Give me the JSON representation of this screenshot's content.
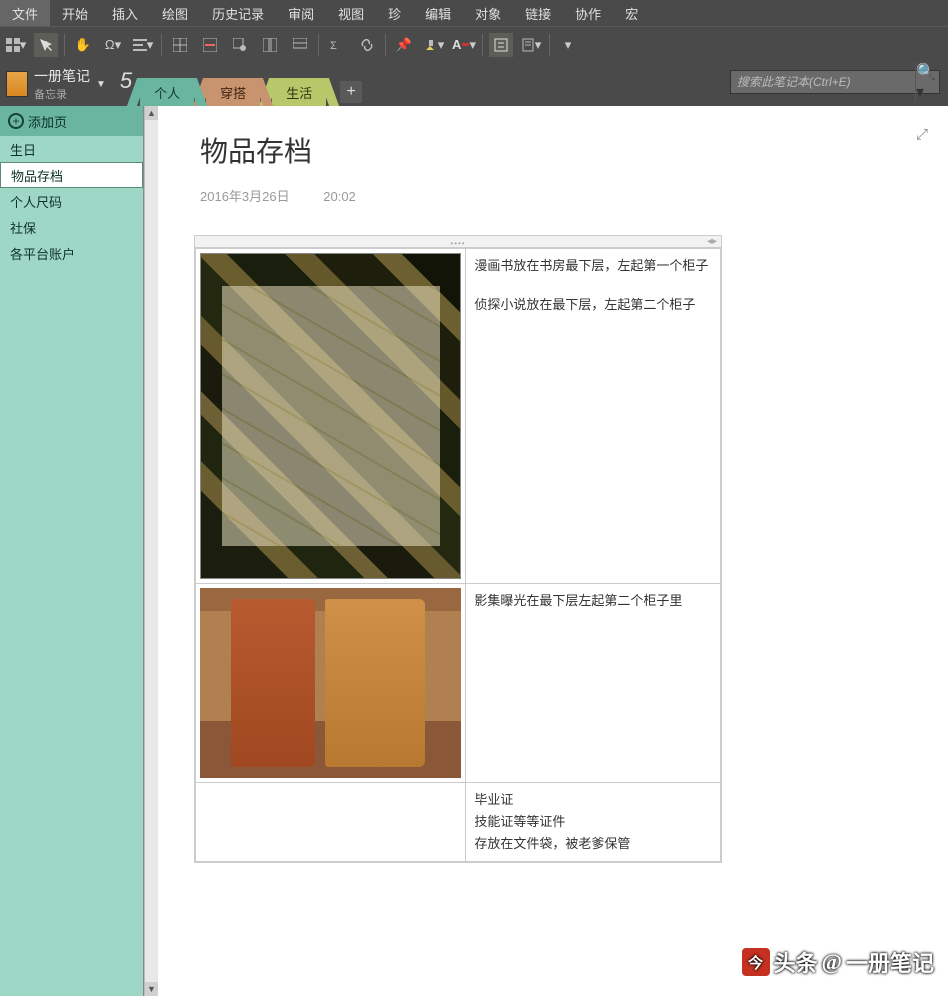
{
  "menu": {
    "items": [
      "文件",
      "开始",
      "插入",
      "绘图",
      "历史记录",
      "审阅",
      "视图",
      "珍",
      "编辑",
      "对象",
      "链接",
      "协作",
      "宏"
    ]
  },
  "toolbar": {
    "icons": [
      "grid-icon",
      "text-select-icon",
      "hand-icon",
      "omega-icon",
      "align-icon",
      "table-icon",
      "delete-row-icon",
      "table-props-icon",
      "table-split-icon",
      "table-merge-icon",
      "formula-icon",
      "link-icon",
      "pin-icon",
      "highlighter-icon",
      "font-color-icon",
      "box-icon",
      "doc-icon",
      "dropdown-icon"
    ]
  },
  "notebook": {
    "title": "一册笔记",
    "subtitle": "备忘录",
    "badge": "5"
  },
  "tabs": {
    "items": [
      "个人",
      "穿搭",
      "生活"
    ],
    "add": "+"
  },
  "search": {
    "placeholder": "搜索此笔记本(Ctrl+E)"
  },
  "sidebar": {
    "addLabel": "添加页",
    "pages": [
      "生日",
      "物品存档",
      "个人尺码",
      "社保",
      "各平台账户"
    ],
    "activeIndex": 1
  },
  "page": {
    "title": "物品存档",
    "date": "2016年3月26日",
    "time": "20:02"
  },
  "content": {
    "rows": [
      {
        "lines": [
          "漫画书放在书房最下层，左起第一个柜子",
          "侦探小说放在最下层，左起第二个柜子"
        ]
      },
      {
        "lines": [
          "影集曝光在最下层左起第二个柜子里"
        ]
      },
      {
        "lines": [
          "毕业证",
          "技能证等等证件",
          "存放在文件袋，被老爹保管"
        ]
      }
    ]
  },
  "watermark": {
    "prefix": "头条",
    "at": "@",
    "name": "一册笔记"
  }
}
